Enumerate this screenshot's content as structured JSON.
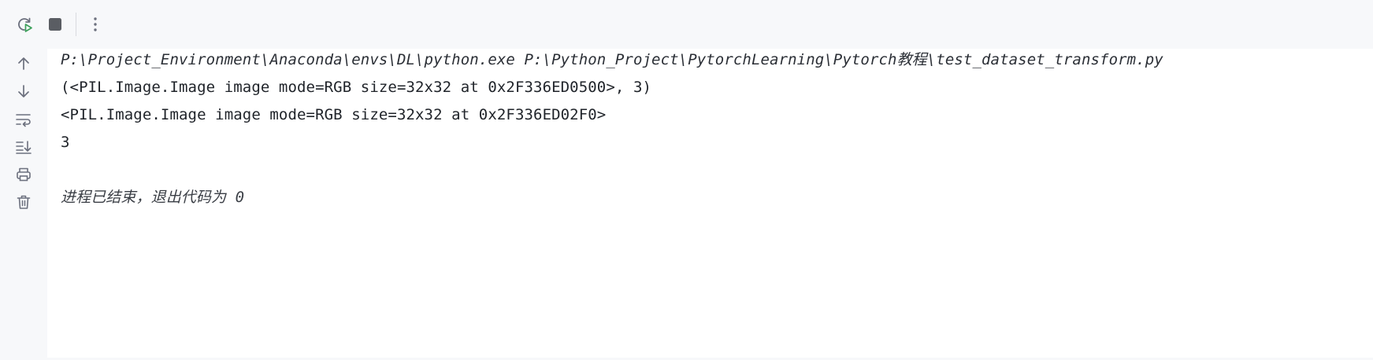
{
  "toolbar": {
    "buttons": [
      {
        "icon": "rerun-icon"
      },
      {
        "icon": "stop-icon"
      },
      {
        "icon": "more-vertical-icon"
      }
    ]
  },
  "sidebar": {
    "buttons": [
      {
        "icon": "arrow-up-icon"
      },
      {
        "icon": "arrow-down-icon"
      },
      {
        "icon": "soft-wrap-icon"
      },
      {
        "icon": "scroll-to-end-icon"
      },
      {
        "icon": "print-icon"
      },
      {
        "icon": "trash-icon"
      }
    ]
  },
  "console": {
    "command": "P:\\Project_Environment\\Anaconda\\envs\\DL\\python.exe P:\\Python_Project\\PytorchLearning\\Pytorch教程\\test_dataset_transform.py",
    "output_lines": [
      "(<PIL.Image.Image image mode=RGB size=32x32 at 0x2F336ED0500>, 3)",
      "<PIL.Image.Image image mode=RGB size=32x32 at 0x2F336ED02F0>",
      "3"
    ],
    "exit_message": "进程已结束，退出代码为 0"
  },
  "colors": {
    "background": "#f7f8fa",
    "console_bg": "#ffffff",
    "text": "#1f2329",
    "icon": "#6c707e",
    "rerun_accent": "#3ca05a"
  }
}
